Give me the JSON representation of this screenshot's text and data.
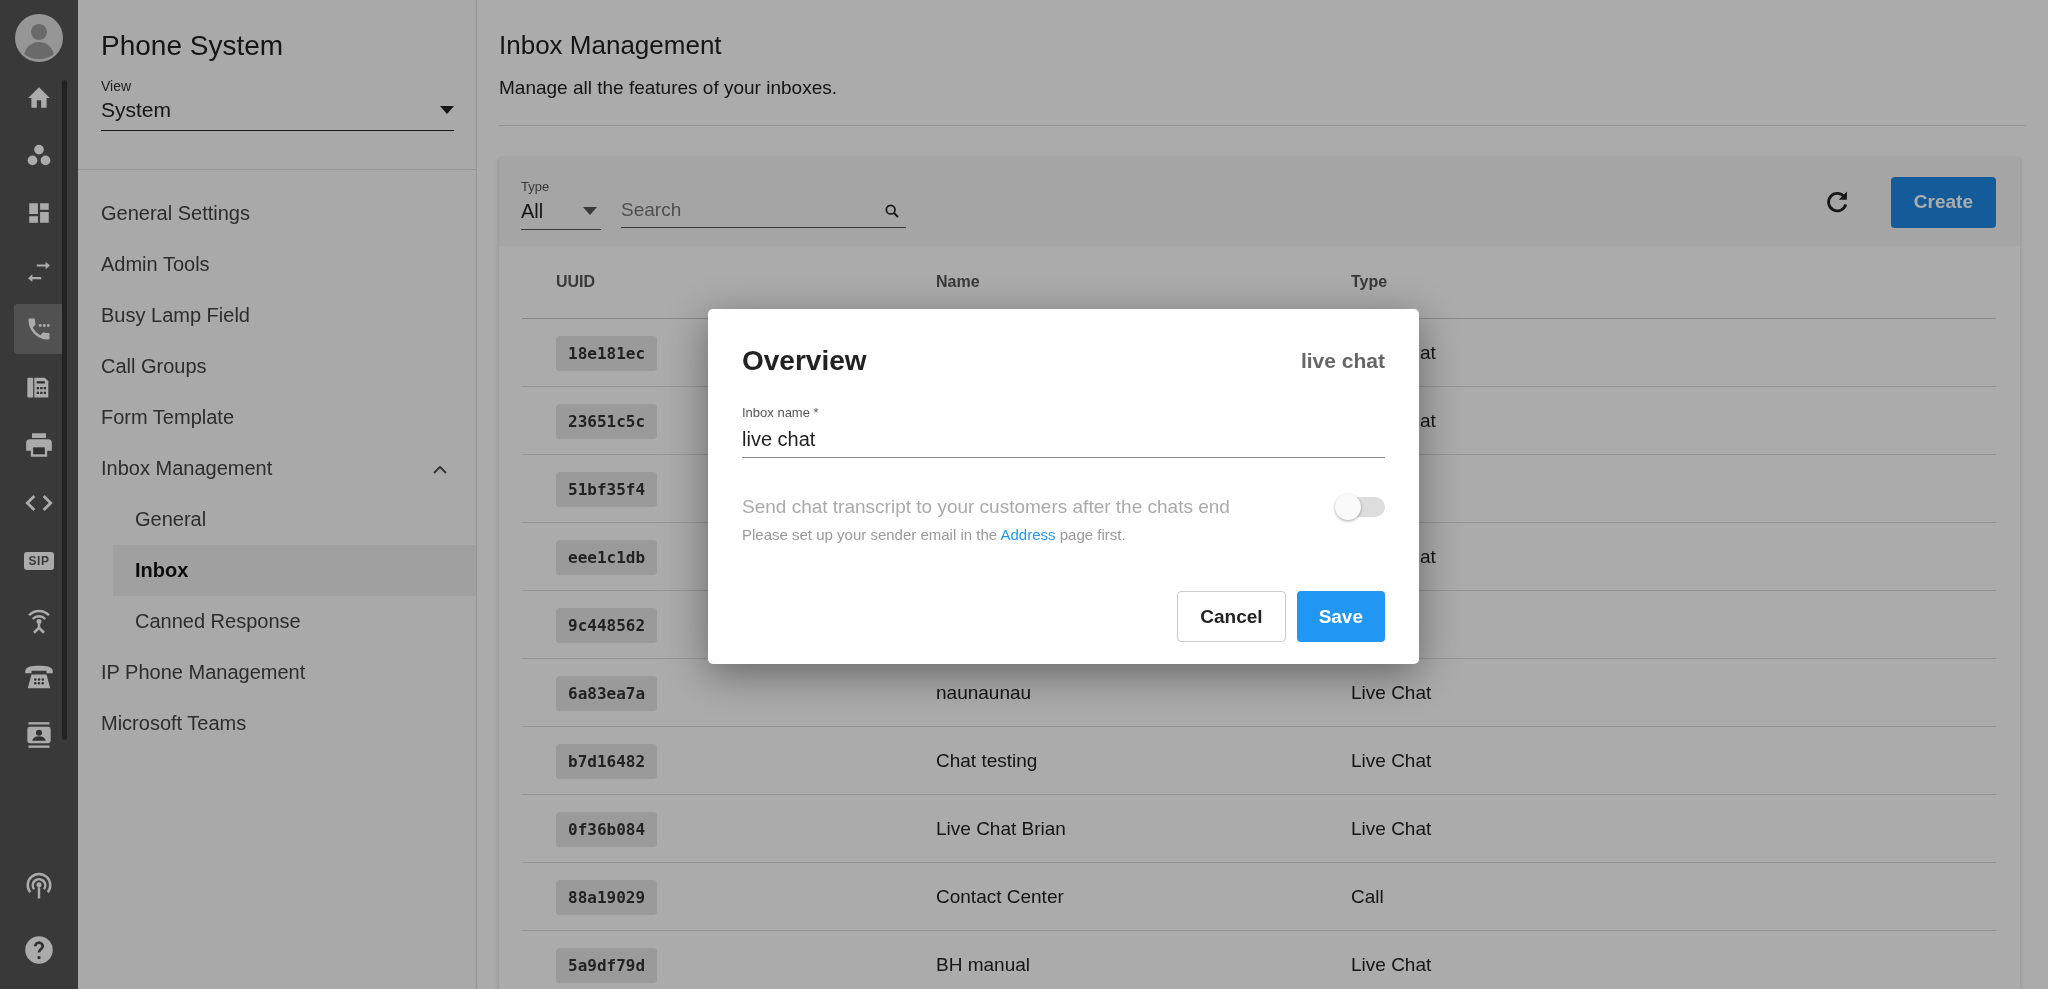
{
  "rail": {
    "items": [
      {
        "kind": "home",
        "selected": false
      },
      {
        "kind": "dots",
        "selected": false
      },
      {
        "kind": "dashboard",
        "selected": false
      },
      {
        "kind": "swap",
        "selected": false
      },
      {
        "kind": "phone",
        "selected": true
      },
      {
        "kind": "fax",
        "selected": false
      },
      {
        "kind": "printer",
        "selected": false
      },
      {
        "kind": "code",
        "selected": false
      },
      {
        "kind": "sip",
        "label": "SIP",
        "selected": false
      },
      {
        "kind": "antenna",
        "selected": false
      },
      {
        "kind": "telephone",
        "selected": false
      },
      {
        "kind": "contact",
        "selected": false
      }
    ],
    "bottom": [
      {
        "kind": "broadcast",
        "selected": false
      },
      {
        "kind": "help",
        "selected": false
      }
    ]
  },
  "sidebar": {
    "title": "Phone System",
    "view_label": "View",
    "view_value": "System",
    "items": [
      {
        "label": "General Settings",
        "selected": false
      },
      {
        "label": "Admin Tools",
        "selected": false
      },
      {
        "label": "Busy Lamp Field",
        "selected": false
      },
      {
        "label": "Call Groups",
        "selected": false
      },
      {
        "label": "Form Template",
        "selected": false
      },
      {
        "label": "Inbox Management",
        "selected": false,
        "expanded": true,
        "children": [
          {
            "label": "General",
            "selected": false
          },
          {
            "label": "Inbox",
            "selected": true
          },
          {
            "label": "Canned Response",
            "selected": false
          }
        ]
      },
      {
        "label": "IP Phone Management",
        "selected": false
      },
      {
        "label": "Microsoft Teams",
        "selected": false
      }
    ]
  },
  "page": {
    "title": "Inbox Management",
    "subtitle": "Manage all the features of your inboxes."
  },
  "toolbar": {
    "type_label": "Type",
    "type_value": "All",
    "search_placeholder": "Search",
    "create": "Create"
  },
  "table": {
    "columns": [
      "UUID",
      "Name",
      "Type"
    ],
    "rows": [
      {
        "uuid": "18e181ec",
        "type": "at"
      },
      {
        "uuid": "23651c5c",
        "type": "at"
      },
      {
        "uuid": "51bf35f4"
      },
      {
        "uuid": "eee1c1db",
        "type": "at"
      },
      {
        "uuid": "9c448562"
      },
      {
        "uuid": "6a83ea7a",
        "name": "naunaunau",
        "type": "Live Chat"
      },
      {
        "uuid": "b7d16482",
        "name": "Chat testing",
        "type": "Live Chat"
      },
      {
        "uuid": "0f36b084",
        "name": "Live Chat Brian",
        "type": "Live Chat"
      },
      {
        "uuid": "88a19029",
        "name": "Contact Center",
        "type": "Call"
      },
      {
        "uuid": "5a9df79d",
        "name": "BH manual",
        "type": "Live Chat"
      }
    ]
  },
  "dialog": {
    "title": "Overview",
    "subtitle": "live chat",
    "field_label": "Inbox name *",
    "field_value": "live chat",
    "toggle_label": "Send chat transcript to your customers after the chats end",
    "toggle_on": false,
    "hint_before": "Please set up your sender email in the",
    "hint_link": "Address",
    "hint_after": "page first.",
    "cancel": "Cancel",
    "save": "Save"
  }
}
